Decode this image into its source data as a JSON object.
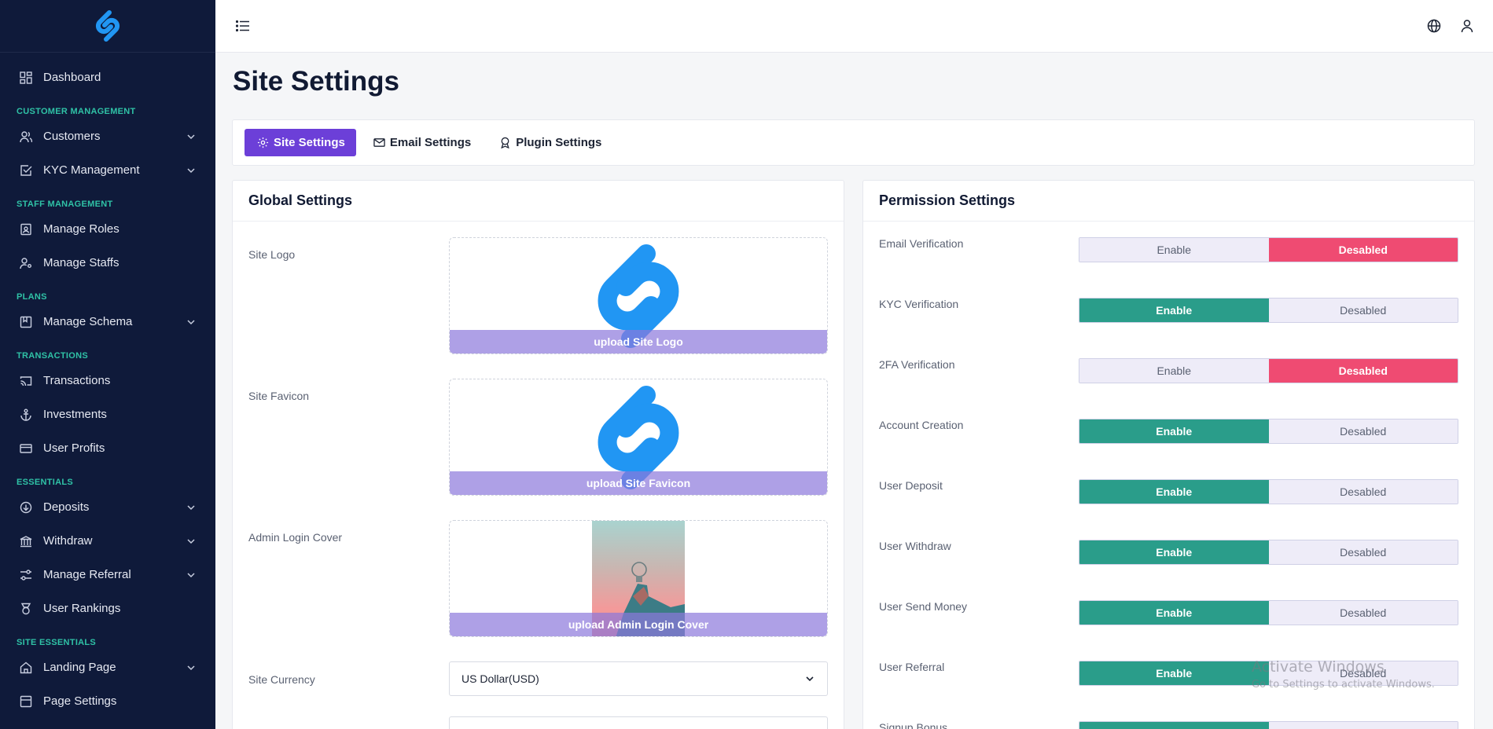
{
  "sidebar": {
    "items": {
      "dashboard": "Dashboard",
      "sec_customer": "CUSTOMER MANAGEMENT",
      "customers": "Customers",
      "kyc": "KYC Management",
      "sec_staff": "STAFF MANAGEMENT",
      "roles": "Manage Roles",
      "staffs": "Manage Staffs",
      "sec_plans": "PLANS",
      "schema": "Manage Schema",
      "sec_transactions": "TRANSACTIONS",
      "transactions": "Transactions",
      "investments": "Investments",
      "profits": "User Profits",
      "sec_essentials": "ESSENTIALS",
      "deposits": "Deposits",
      "withdraw": "Withdraw",
      "referral": "Manage Referral",
      "rankings": "User Rankings",
      "sec_site": "SITE ESSENTIALS",
      "landing": "Landing Page",
      "page_settings": "Page Settings"
    }
  },
  "page": {
    "title": "Site Settings"
  },
  "tabs": {
    "site": "Site Settings",
    "email": "Email Settings",
    "plugin": "Plugin Settings"
  },
  "global": {
    "title": "Global Settings",
    "logo_label": "Site Logo",
    "logo_upload": "upload Site Logo",
    "favicon_label": "Site Favicon",
    "favicon_upload": "upload Site Favicon",
    "cover_label": "Admin Login Cover",
    "cover_upload": "upload Admin Login Cover",
    "currency_label": "Site Currency",
    "currency_value": "US Dollar(USD)"
  },
  "permissions": {
    "title": "Permission Settings",
    "enable_label": "Enable",
    "disable_label": "Desabled",
    "rows": [
      {
        "label": "Email Verification",
        "enabled": false
      },
      {
        "label": "KYC Verification",
        "enabled": true
      },
      {
        "label": "2FA Verification",
        "enabled": false
      },
      {
        "label": "Account Creation",
        "enabled": true
      },
      {
        "label": "User Deposit",
        "enabled": true
      },
      {
        "label": "User Withdraw",
        "enabled": true
      },
      {
        "label": "User Send Money",
        "enabled": true
      },
      {
        "label": "User Referral",
        "enabled": true
      },
      {
        "label": "Signup Bonus",
        "enabled": true
      }
    ]
  },
  "watermark": {
    "line1": "Activate Windows",
    "line2": "Go to Settings to activate Windows."
  },
  "colors": {
    "sidebar_bg": "#0f1a3a",
    "section_accent": "#2fc2a6",
    "primary": "#6c3fd8",
    "enable_on": "#2a9d8a",
    "disable_on": "#ef4b72",
    "logo_blue": "#2196f3"
  }
}
